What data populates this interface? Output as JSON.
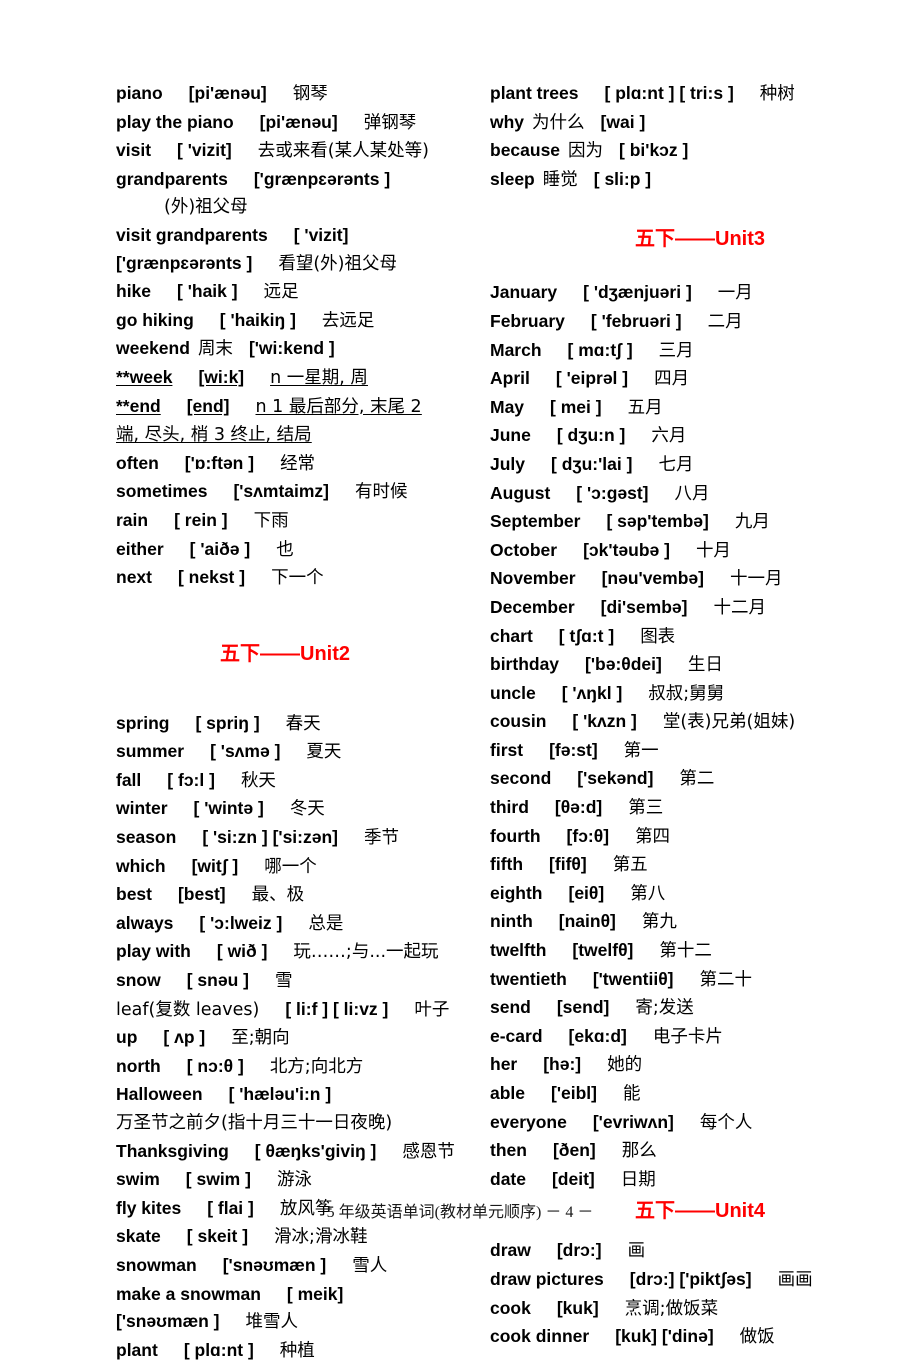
{
  "document": {
    "footer_text": "5 年级英语单词(教材单元顺序) － 4 －",
    "page_number": "4",
    "accent_color": "#ff0000",
    "text_color": "#000000",
    "background_color": "#ffffff"
  },
  "left_column": {
    "entries_before_unit2": [
      {
        "word": "piano",
        "phonetic": "[pi'ænəu]",
        "meaning": "钢琴"
      },
      {
        "word": "play the piano",
        "phonetic": "[pi'ænəu]",
        "meaning": "弹钢琴"
      },
      {
        "word": "visit",
        "phonetic": "[ 'vizit]",
        "meaning": "去或来看(某人某处等)"
      },
      {
        "word": "grandparents",
        "phonetic": "['grænpɛərənts ]",
        "meaning": ""
      },
      {
        "word": "",
        "phonetic": "",
        "meaning": "(外)祖父母",
        "indent": true
      },
      {
        "word": "visit   grandparents",
        "phonetic": "[ 'vizit]",
        "meaning": ""
      },
      {
        "word": "['grænpɛərənts ]",
        "phonetic": "",
        "meaning": "看望(外)祖父母"
      },
      {
        "word": "hike",
        "phonetic": "[ 'haik ]",
        "meaning": "远足"
      },
      {
        "word": "go hiking",
        "phonetic": "[ 'haikiŋ ]",
        "meaning": "去远足"
      },
      {
        "word": "weekend",
        "phonetic": "['wi:kend ]",
        "meaning": "周末",
        "meaning_before_phonetic": true
      },
      {
        "word": "**week",
        "phonetic": "[wi:k]",
        "meaning": "n 一星期, 周",
        "underline": true
      },
      {
        "word": "**end",
        "phonetic": "[end]",
        "meaning": "n 1 最后部分, 末尾 2",
        "underline": true
      },
      {
        "word": "",
        "phonetic": "",
        "meaning": "端, 尽头, 梢 3 终止, 结局",
        "underline": true,
        "continuation": true
      },
      {
        "word": "often",
        "phonetic": "['ɒ:ftən ]",
        "meaning": "经常"
      },
      {
        "word": "sometimes",
        "phonetic": "['sʌmtaimz]",
        "meaning": "有时候"
      },
      {
        "word": "rain",
        "phonetic": "[ rein ]",
        "meaning": "下雨"
      },
      {
        "word": "either",
        "phonetic": "[ 'aiðə ]",
        "meaning": "也"
      },
      {
        "word": "next",
        "phonetic": "[ nekst ]",
        "meaning": "下一个"
      }
    ],
    "unit2_heading": "五下——Unit2",
    "unit2_heading_cn": "五下",
    "unit2_heading_en": "——Unit2",
    "unit2_entries": [
      {
        "word": "spring",
        "phonetic": "[ spriŋ ]",
        "meaning": "春天"
      },
      {
        "word": "summer",
        "phonetic": "[ 'sʌmə ]",
        "meaning": "夏天"
      },
      {
        "word": "fall",
        "phonetic": "[ fɔ:l ]",
        "meaning": "秋天"
      },
      {
        "word": "winter",
        "phonetic": "[ 'wintə ]",
        "meaning": "冬天"
      },
      {
        "word": "season",
        "phonetic": "[ 'si:zn ]   ['si:zən]",
        "meaning": "季节"
      },
      {
        "word": "which",
        "phonetic": "[witʃ ]",
        "meaning": "哪一个"
      },
      {
        "word": "best",
        "phonetic": "[best]",
        "meaning": "最、极"
      },
      {
        "word": "always",
        "phonetic": "[ 'ɔ:lweiz ]",
        "meaning": "总是"
      },
      {
        "word": "play with",
        "phonetic": "[ wið ]",
        "meaning": "玩……;与...一起玩"
      },
      {
        "word": "snow",
        "phonetic": "[ snəu ]",
        "meaning": "雪"
      },
      {
        "word": "leaf(复数 leaves)",
        "phonetic": "[ li:f ] [ li:vz ]",
        "meaning": "叶子"
      },
      {
        "word": "up",
        "phonetic": "[ ʌp ]",
        "meaning": "至;朝向"
      },
      {
        "word": "north",
        "phonetic": "[ nɔ:θ ]",
        "meaning": "北方;向北方"
      },
      {
        "word": "Halloween",
        "phonetic": "[ 'hæləu'i:n ]",
        "meaning": ""
      },
      {
        "word": "",
        "phonetic": "",
        "meaning": "万圣节之前夕(指十月三十一日夜晚)",
        "continuation": true
      },
      {
        "word": "Thanksgiving",
        "phonetic": "[ θæŋks'giviŋ ]",
        "meaning": "感恩节"
      },
      {
        "word": "swim",
        "phonetic": "[ swim ]",
        "meaning": "游泳"
      },
      {
        "word": "fly kites",
        "phonetic": "[ flai ]",
        "meaning": "放风筝"
      },
      {
        "word": "skate",
        "phonetic": "[ skeit ]",
        "meaning": "滑冰;滑冰鞋"
      },
      {
        "word": "snowman",
        "phonetic": "['snəʊmæn ]",
        "meaning": "雪人"
      },
      {
        "word": "make a snowman",
        "phonetic": "[ meik]",
        "meaning": ""
      },
      {
        "word": "['snəʊmæn ]",
        "phonetic": "",
        "meaning": "堆雪人"
      },
      {
        "word": "plant",
        "phonetic": "[ plɑ:nt ]",
        "meaning": "种植"
      }
    ]
  },
  "right_column": {
    "entries_before_unit3": [
      {
        "word": "plant trees",
        "phonetic": "[ plɑ:nt ] [ tri:s ]",
        "meaning": "种树"
      },
      {
        "word": "why",
        "phonetic": "[wai ]",
        "meaning": "为什么",
        "meaning_before_phonetic": true
      },
      {
        "word": "because",
        "phonetic": "[ bi'kɔz ]",
        "meaning": "因为",
        "meaning_before_phonetic": true
      },
      {
        "word": "sleep",
        "phonetic": "[ sli:p ]",
        "meaning": "睡觉",
        "meaning_before_phonetic": true
      }
    ],
    "unit3_heading": "五下——Unit3",
    "unit3_heading_cn": "五下",
    "unit3_heading_en": "——Unit3",
    "unit3_entries": [
      {
        "word": "January",
        "phonetic": "[ 'dʒænjuəri ]",
        "meaning": "一月"
      },
      {
        "word": "February",
        "phonetic": "[ 'februəri ]",
        "meaning": "二月"
      },
      {
        "word": "March",
        "phonetic": "[ mɑ:tʃ ]",
        "meaning": "三月"
      },
      {
        "word": "April",
        "phonetic": "[ 'eiprəl ]",
        "meaning": "四月"
      },
      {
        "word": "May",
        "phonetic": "[ mei ]",
        "meaning": "五月"
      },
      {
        "word": "June",
        "phonetic": "[ dʒu:n ]",
        "meaning": "六月"
      },
      {
        "word": "July",
        "phonetic": "[ dʒu:'lai ]",
        "meaning": "七月"
      },
      {
        "word": "August",
        "phonetic": "[ 'ɔ:gəst]",
        "meaning": "八月"
      },
      {
        "word": "September",
        "phonetic": "[ səp'tembə]",
        "meaning": "九月"
      },
      {
        "word": "October",
        "phonetic": "[ɔk'təubə ]",
        "meaning": "十月"
      },
      {
        "word": "November",
        "phonetic": "[nəu'vembə]",
        "meaning": "十一月"
      },
      {
        "word": "December",
        "phonetic": "[di'sembə]",
        "meaning": "十二月"
      },
      {
        "word": "chart",
        "phonetic": "[ tʃɑ:t ]",
        "meaning": "图表"
      },
      {
        "word": "birthday",
        "phonetic": "['bə:θdei]",
        "meaning": "生日"
      },
      {
        "word": "uncle",
        "phonetic": "[ 'ʌŋkl ]",
        "meaning": "叔叔;舅舅"
      },
      {
        "word": "cousin",
        "phonetic": "[ 'kʌzn ]",
        "meaning": "堂(表)兄弟(姐妹)"
      },
      {
        "word": "first",
        "phonetic": "[fə:st]",
        "meaning": "第一"
      },
      {
        "word": "second",
        "phonetic": "['sekənd]",
        "meaning": "第二"
      },
      {
        "word": "third",
        "phonetic": "[θə:d]",
        "meaning": "第三"
      },
      {
        "word": "fourth",
        "phonetic": "[fɔ:θ]",
        "meaning": "第四"
      },
      {
        "word": "fifth",
        "phonetic": "[fifθ]",
        "meaning": "第五"
      },
      {
        "word": "eighth",
        "phonetic": "[eiθ]",
        "meaning": "第八"
      },
      {
        "word": "ninth",
        "phonetic": "[nainθ]",
        "meaning": "第九"
      },
      {
        "word": "twelfth",
        "phonetic": "[twelfθ]",
        "meaning": "第十二"
      },
      {
        "word": "twentieth",
        "phonetic": "['twentiiθ]",
        "meaning": "第二十"
      },
      {
        "word": "send",
        "phonetic": "[send]",
        "meaning": "寄;发送"
      },
      {
        "word": "e-card",
        "phonetic": "[ekɑ:d]",
        "meaning": "电子卡片"
      },
      {
        "word": "her",
        "phonetic": "[hə:]",
        "meaning": "她的"
      },
      {
        "word": "able",
        "phonetic": "['eibl]",
        "meaning": "能"
      },
      {
        "word": "everyone",
        "phonetic": "['evriwʌn]",
        "meaning": "每个人"
      },
      {
        "word": "then",
        "phonetic": "[ðen]",
        "meaning": "那么"
      },
      {
        "word": "date",
        "phonetic": "[deit]",
        "meaning": "日期"
      }
    ],
    "unit4_heading": "五下——Unit4",
    "unit4_heading_cn": "五下",
    "unit4_heading_en": "——Unit4",
    "unit4_entries": [
      {
        "word": "draw",
        "phonetic": "[drɔ:]",
        "meaning": "画"
      },
      {
        "word": "draw pictures",
        "phonetic": "[drɔ:] ['piktʃəs]",
        "meaning": "画画"
      },
      {
        "word": "cook",
        "phonetic": "[kuk]",
        "meaning": "烹调;做饭菜"
      },
      {
        "word": "cook dinner",
        "phonetic": "[kuk]   ['dinə]",
        "meaning": "做饭"
      }
    ]
  }
}
